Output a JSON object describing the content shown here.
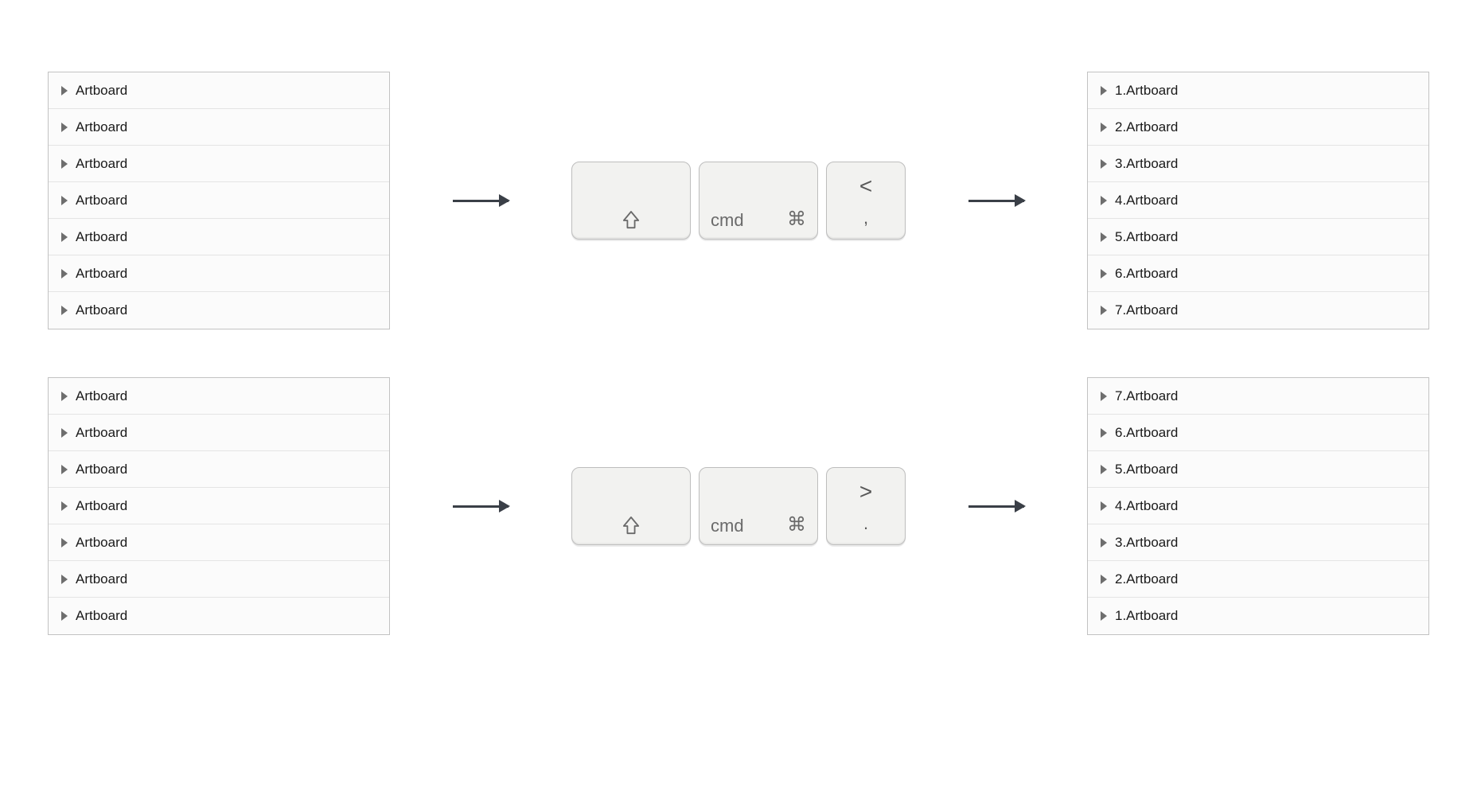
{
  "rows": [
    {
      "left": [
        "Artboard",
        "Artboard",
        "Artboard",
        "Artboard",
        "Artboard",
        "Artboard",
        "Artboard"
      ],
      "keys": {
        "cmd": "cmd",
        "cmd_sym": "⌘",
        "top": "<",
        "bottom": ","
      },
      "right": [
        "1.Artboard",
        "2.Artboard",
        "3.Artboard",
        "4.Artboard",
        "5.Artboard",
        "6.Artboard",
        "7.Artboard"
      ]
    },
    {
      "left": [
        "Artboard",
        "Artboard",
        "Artboard",
        "Artboard",
        "Artboard",
        "Artboard",
        "Artboard"
      ],
      "keys": {
        "cmd": "cmd",
        "cmd_sym": "⌘",
        "top": ">",
        "bottom": "."
      },
      "right": [
        "7.Artboard",
        "6.Artboard",
        "5.Artboard",
        "4.Artboard",
        "3.Artboard",
        "2.Artboard",
        "1.Artboard"
      ]
    }
  ]
}
